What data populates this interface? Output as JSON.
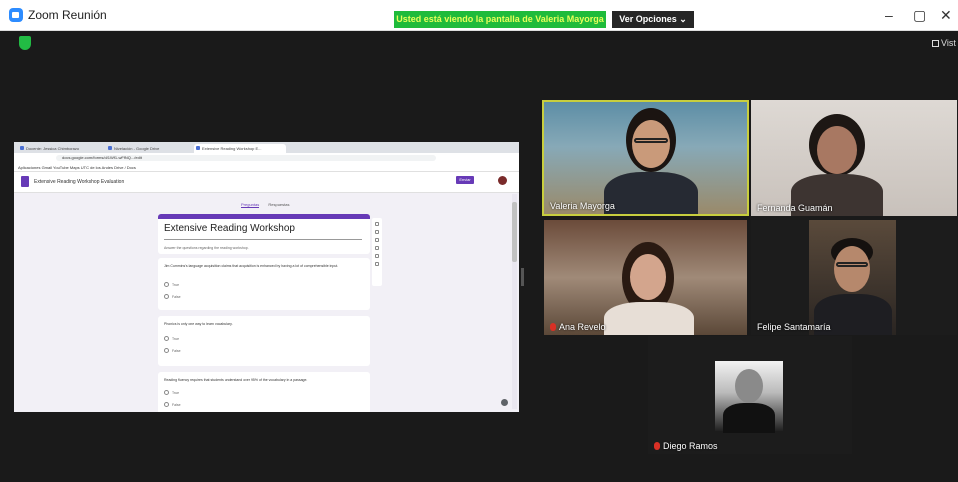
{
  "window": {
    "title": "Zoom Reunión",
    "share_banner": "Usted está viendo la pantalla de Valeria Mayorga",
    "view_options": "Ver Opciones ⌄",
    "minimize": "–",
    "maximize": "▢",
    "close": "✕",
    "view_toggle": "Vist"
  },
  "shared_screen": {
    "browser_tabs": [
      "Docente: Jessica Chimborazo",
      "Nivelación - Google Drive",
      "Extensive Reading Workshop E..."
    ],
    "url": "docs.google.com/forms/d/1Wf1-wFfNQ.../edit",
    "bookmarks": "Aplicaciones   Gmail   YouTube   Maps   UTC de los Andes   Drive / Docs",
    "form_doc_title": "Extensive Reading Workshop Evaluation",
    "send_label": "Enviar",
    "form_tabs": [
      "Preguntas",
      "Respuestas"
    ],
    "form_title": "Extensive Reading Workshop",
    "form_description": "Answer the questions regarding the reading workshop.",
    "questions": [
      {
        "text": "Jim Cummins's language acquisition claims that acquisition is enhanced by having a lot of comprehensible input.",
        "options": [
          "True",
          "False"
        ]
      },
      {
        "text": "Phonics is only one way to learn vocabulary.",
        "options": [
          "True",
          "False"
        ]
      },
      {
        "text": "Reading fluency requires that students understand over 95% of the vocabulary in a passage.",
        "options": [
          "True",
          "False"
        ]
      }
    ]
  },
  "participants": [
    {
      "name": "Valeria Mayorga",
      "muted": false,
      "active_speaker": true
    },
    {
      "name": "Fernanda Guamán",
      "muted": false,
      "active_speaker": false
    },
    {
      "name": "Ana Revelo",
      "muted": true,
      "active_speaker": false
    },
    {
      "name": "Felipe Santamaría",
      "muted": false,
      "active_speaker": false
    },
    {
      "name": "Diego Ramos",
      "muted": true,
      "active_speaker": false
    }
  ],
  "colors": {
    "share_banner_bg": "#1fbb3b",
    "active_speaker_border": "#c8ce3e",
    "forms_accent": "#673ab7",
    "stage_bg": "#1a1a1a"
  }
}
